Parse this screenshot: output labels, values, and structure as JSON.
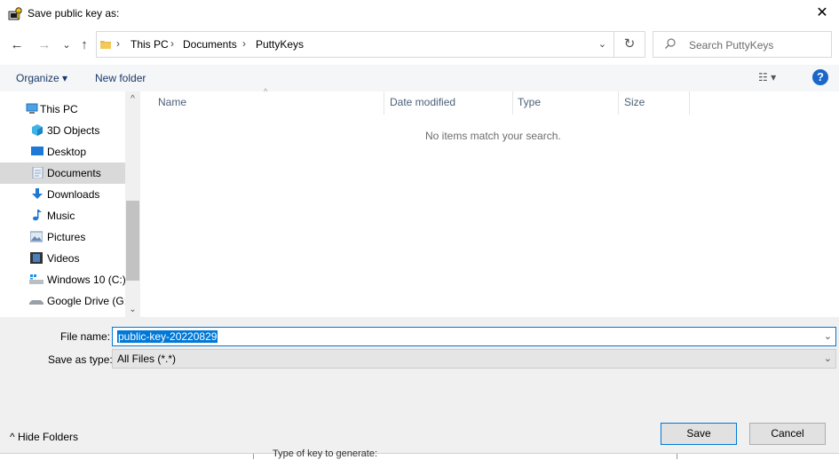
{
  "window": {
    "title": "Save public key as:",
    "close_glyph": "✕"
  },
  "nav": {
    "back_glyph": "←",
    "forward_glyph": "→",
    "recent_glyph": "⌄",
    "up_glyph": "↑",
    "breadcrumbs": [
      "This PC",
      "Documents",
      "PuttyKeys"
    ],
    "separator": "›",
    "dropdown_glyph": "⌄",
    "refresh_glyph": "↻",
    "search_placeholder": "Search PuttyKeys"
  },
  "toolbar": {
    "organize_label": "Organize ▾",
    "new_folder_label": "New folder",
    "view_glyph": "☷ ▾",
    "help_label": "?"
  },
  "sidebar": {
    "items": [
      {
        "label": "This PC",
        "icon": "computer-icon"
      },
      {
        "label": "3D Objects",
        "icon": "3d-objects-icon"
      },
      {
        "label": "Desktop",
        "icon": "desktop-icon"
      },
      {
        "label": "Documents",
        "icon": "documents-icon",
        "selected": true
      },
      {
        "label": "Downloads",
        "icon": "download-icon"
      },
      {
        "label": "Music",
        "icon": "music-icon"
      },
      {
        "label": "Pictures",
        "icon": "pictures-icon"
      },
      {
        "label": "Videos",
        "icon": "videos-icon"
      },
      {
        "label": "Windows 10 (C:)",
        "icon": "drive-icon"
      },
      {
        "label": "Google Drive (G:",
        "icon": "network-drive-icon"
      }
    ]
  },
  "filelist": {
    "columns": [
      "Name",
      "Date modified",
      "Type",
      "Size"
    ],
    "sort_glyph": "^",
    "empty_message": "No items match your search."
  },
  "form": {
    "filename_label": "File name:",
    "filename_value": "public-key-20220829",
    "savetype_label": "Save as type:",
    "savetype_value": "All Files (*.*)"
  },
  "footer": {
    "hide_folders_label": "^  Hide Folders",
    "save_label": "Save",
    "cancel_label": "Cancel"
  },
  "background": {
    "partial_text": "Type of key to generate:"
  },
  "colors": {
    "accent": "#0078d7",
    "selection": "#d9d9d9",
    "panel": "#f0f0f0"
  }
}
